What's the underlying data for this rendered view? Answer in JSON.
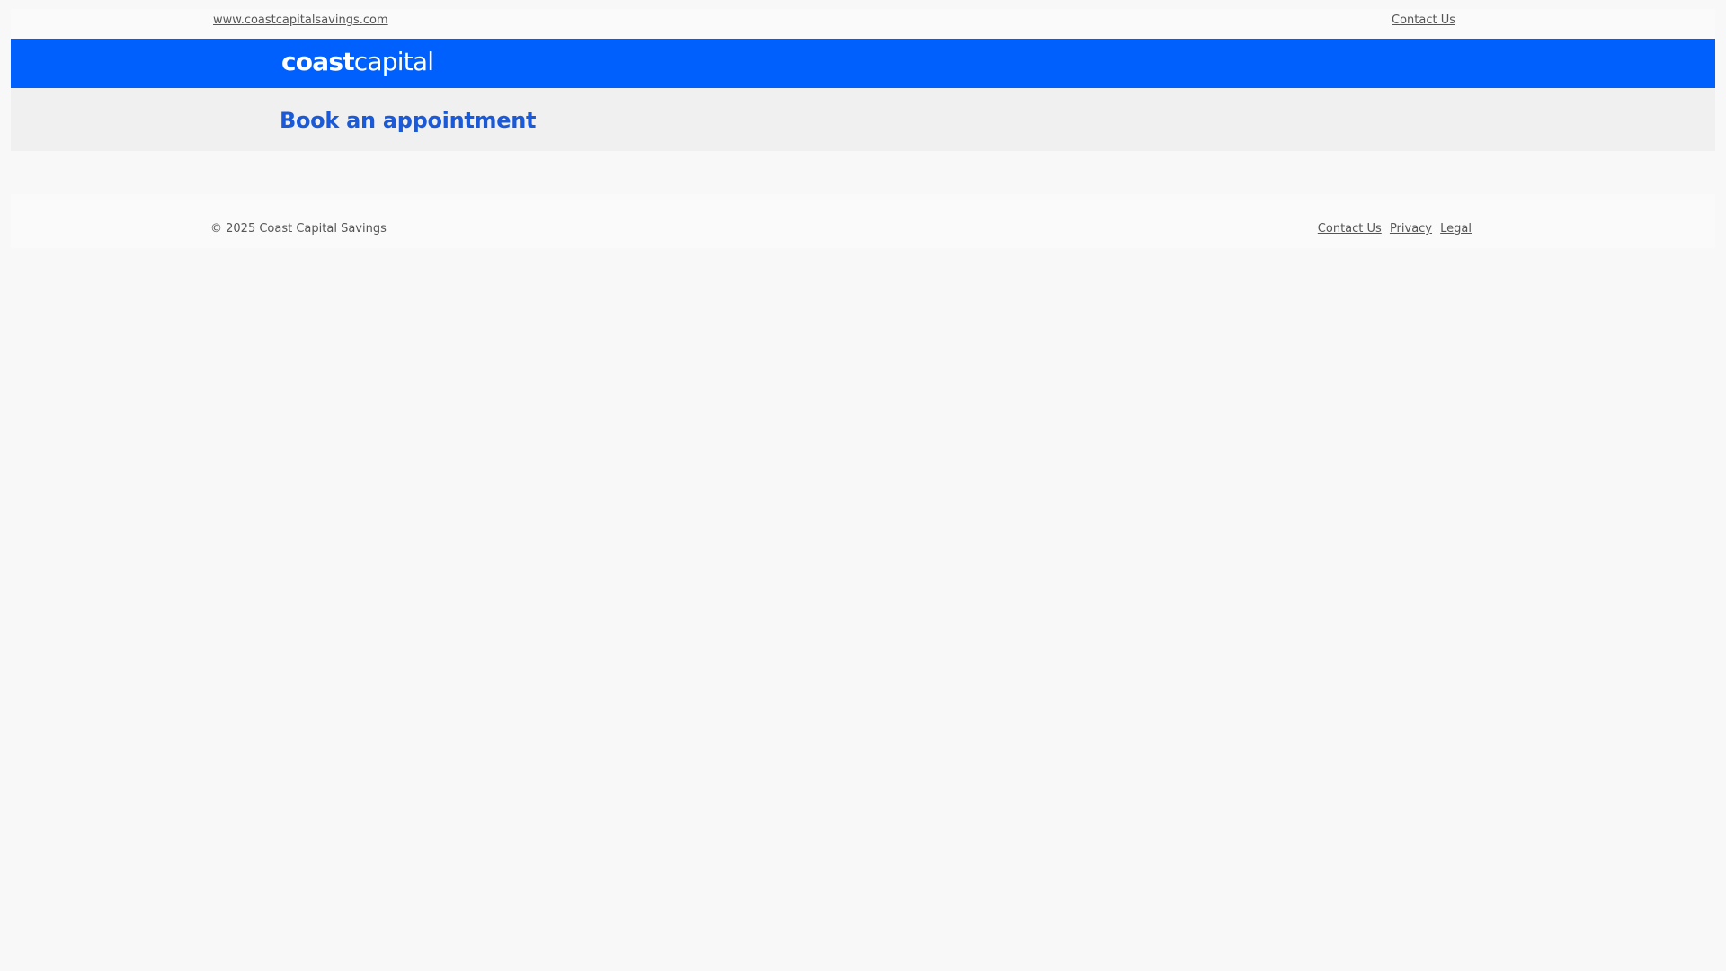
{
  "utility_bar": {
    "site_link": "www.coastcapitalsavings.com",
    "contact_link": "Contact Us"
  },
  "brand": {
    "logo_bold": "coast",
    "logo_light": "capital",
    "color": "#0060fe"
  },
  "main": {
    "title": "Book an appointment",
    "title_color": "#1a5ad8"
  },
  "footer": {
    "copyright": "© 2025 Coast Capital Savings",
    "links": {
      "contact": "Contact Us",
      "privacy": "Privacy",
      "legal": "Legal"
    }
  }
}
